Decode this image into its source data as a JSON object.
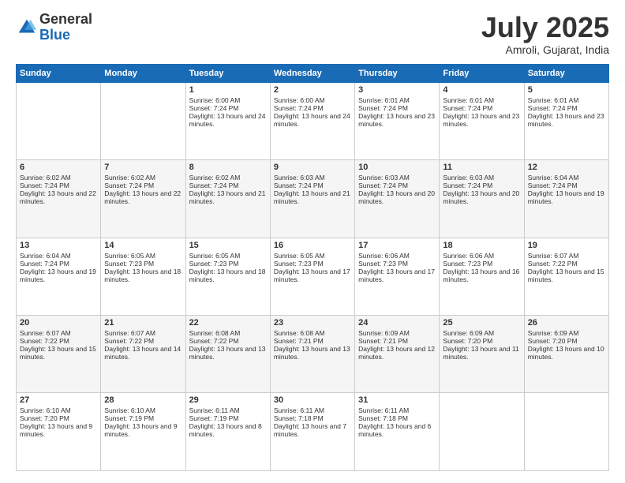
{
  "logo": {
    "general": "General",
    "blue": "Blue"
  },
  "header": {
    "month": "July 2025",
    "location": "Amroli, Gujarat, India"
  },
  "weekdays": [
    "Sunday",
    "Monday",
    "Tuesday",
    "Wednesday",
    "Thursday",
    "Friday",
    "Saturday"
  ],
  "weeks": [
    [
      {
        "day": "",
        "sunrise": "",
        "sunset": "",
        "daylight": ""
      },
      {
        "day": "",
        "sunrise": "",
        "sunset": "",
        "daylight": ""
      },
      {
        "day": "1",
        "sunrise": "Sunrise: 6:00 AM",
        "sunset": "Sunset: 7:24 PM",
        "daylight": "Daylight: 13 hours and 24 minutes."
      },
      {
        "day": "2",
        "sunrise": "Sunrise: 6:00 AM",
        "sunset": "Sunset: 7:24 PM",
        "daylight": "Daylight: 13 hours and 24 minutes."
      },
      {
        "day": "3",
        "sunrise": "Sunrise: 6:01 AM",
        "sunset": "Sunset: 7:24 PM",
        "daylight": "Daylight: 13 hours and 23 minutes."
      },
      {
        "day": "4",
        "sunrise": "Sunrise: 6:01 AM",
        "sunset": "Sunset: 7:24 PM",
        "daylight": "Daylight: 13 hours and 23 minutes."
      },
      {
        "day": "5",
        "sunrise": "Sunrise: 6:01 AM",
        "sunset": "Sunset: 7:24 PM",
        "daylight": "Daylight: 13 hours and 23 minutes."
      }
    ],
    [
      {
        "day": "6",
        "sunrise": "Sunrise: 6:02 AM",
        "sunset": "Sunset: 7:24 PM",
        "daylight": "Daylight: 13 hours and 22 minutes."
      },
      {
        "day": "7",
        "sunrise": "Sunrise: 6:02 AM",
        "sunset": "Sunset: 7:24 PM",
        "daylight": "Daylight: 13 hours and 22 minutes."
      },
      {
        "day": "8",
        "sunrise": "Sunrise: 6:02 AM",
        "sunset": "Sunset: 7:24 PM",
        "daylight": "Daylight: 13 hours and 21 minutes."
      },
      {
        "day": "9",
        "sunrise": "Sunrise: 6:03 AM",
        "sunset": "Sunset: 7:24 PM",
        "daylight": "Daylight: 13 hours and 21 minutes."
      },
      {
        "day": "10",
        "sunrise": "Sunrise: 6:03 AM",
        "sunset": "Sunset: 7:24 PM",
        "daylight": "Daylight: 13 hours and 20 minutes."
      },
      {
        "day": "11",
        "sunrise": "Sunrise: 6:03 AM",
        "sunset": "Sunset: 7:24 PM",
        "daylight": "Daylight: 13 hours and 20 minutes."
      },
      {
        "day": "12",
        "sunrise": "Sunrise: 6:04 AM",
        "sunset": "Sunset: 7:24 PM",
        "daylight": "Daylight: 13 hours and 19 minutes."
      }
    ],
    [
      {
        "day": "13",
        "sunrise": "Sunrise: 6:04 AM",
        "sunset": "Sunset: 7:24 PM",
        "daylight": "Daylight: 13 hours and 19 minutes."
      },
      {
        "day": "14",
        "sunrise": "Sunrise: 6:05 AM",
        "sunset": "Sunset: 7:23 PM",
        "daylight": "Daylight: 13 hours and 18 minutes."
      },
      {
        "day": "15",
        "sunrise": "Sunrise: 6:05 AM",
        "sunset": "Sunset: 7:23 PM",
        "daylight": "Daylight: 13 hours and 18 minutes."
      },
      {
        "day": "16",
        "sunrise": "Sunrise: 6:05 AM",
        "sunset": "Sunset: 7:23 PM",
        "daylight": "Daylight: 13 hours and 17 minutes."
      },
      {
        "day": "17",
        "sunrise": "Sunrise: 6:06 AM",
        "sunset": "Sunset: 7:23 PM",
        "daylight": "Daylight: 13 hours and 17 minutes."
      },
      {
        "day": "18",
        "sunrise": "Sunrise: 6:06 AM",
        "sunset": "Sunset: 7:23 PM",
        "daylight": "Daylight: 13 hours and 16 minutes."
      },
      {
        "day": "19",
        "sunrise": "Sunrise: 6:07 AM",
        "sunset": "Sunset: 7:22 PM",
        "daylight": "Daylight: 13 hours and 15 minutes."
      }
    ],
    [
      {
        "day": "20",
        "sunrise": "Sunrise: 6:07 AM",
        "sunset": "Sunset: 7:22 PM",
        "daylight": "Daylight: 13 hours and 15 minutes."
      },
      {
        "day": "21",
        "sunrise": "Sunrise: 6:07 AM",
        "sunset": "Sunset: 7:22 PM",
        "daylight": "Daylight: 13 hours and 14 minutes."
      },
      {
        "day": "22",
        "sunrise": "Sunrise: 6:08 AM",
        "sunset": "Sunset: 7:22 PM",
        "daylight": "Daylight: 13 hours and 13 minutes."
      },
      {
        "day": "23",
        "sunrise": "Sunrise: 6:08 AM",
        "sunset": "Sunset: 7:21 PM",
        "daylight": "Daylight: 13 hours and 13 minutes."
      },
      {
        "day": "24",
        "sunrise": "Sunrise: 6:09 AM",
        "sunset": "Sunset: 7:21 PM",
        "daylight": "Daylight: 13 hours and 12 minutes."
      },
      {
        "day": "25",
        "sunrise": "Sunrise: 6:09 AM",
        "sunset": "Sunset: 7:20 PM",
        "daylight": "Daylight: 13 hours and 11 minutes."
      },
      {
        "day": "26",
        "sunrise": "Sunrise: 6:09 AM",
        "sunset": "Sunset: 7:20 PM",
        "daylight": "Daylight: 13 hours and 10 minutes."
      }
    ],
    [
      {
        "day": "27",
        "sunrise": "Sunrise: 6:10 AM",
        "sunset": "Sunset: 7:20 PM",
        "daylight": "Daylight: 13 hours and 9 minutes."
      },
      {
        "day": "28",
        "sunrise": "Sunrise: 6:10 AM",
        "sunset": "Sunset: 7:19 PM",
        "daylight": "Daylight: 13 hours and 9 minutes."
      },
      {
        "day": "29",
        "sunrise": "Sunrise: 6:11 AM",
        "sunset": "Sunset: 7:19 PM",
        "daylight": "Daylight: 13 hours and 8 minutes."
      },
      {
        "day": "30",
        "sunrise": "Sunrise: 6:11 AM",
        "sunset": "Sunset: 7:18 PM",
        "daylight": "Daylight: 13 hours and 7 minutes."
      },
      {
        "day": "31",
        "sunrise": "Sunrise: 6:11 AM",
        "sunset": "Sunset: 7:18 PM",
        "daylight": "Daylight: 13 hours and 6 minutes."
      },
      {
        "day": "",
        "sunrise": "",
        "sunset": "",
        "daylight": ""
      },
      {
        "day": "",
        "sunrise": "",
        "sunset": "",
        "daylight": ""
      }
    ]
  ]
}
